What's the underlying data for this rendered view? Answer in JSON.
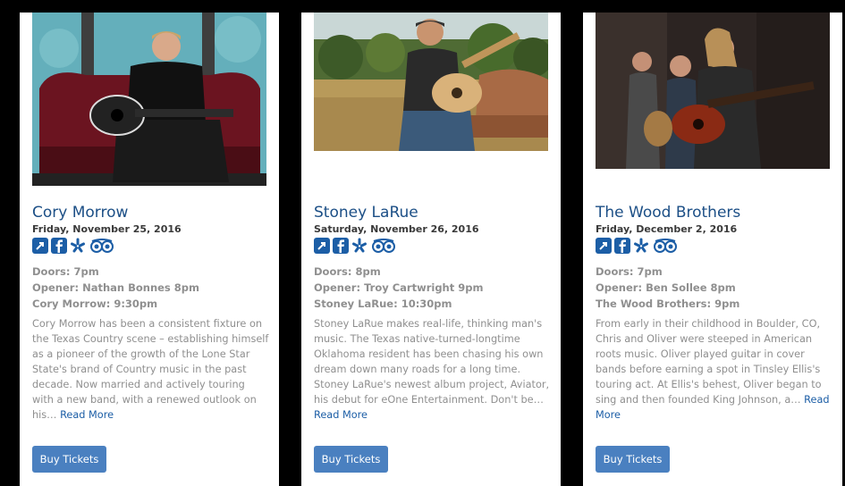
{
  "events": [
    {
      "artist": "Cory Morrow",
      "date": "Friday, November 25, 2016",
      "doors": "Doors: 7pm",
      "opener": "Opener: Nathan Bonnes 8pm",
      "headliner": "Cory Morrow: 9:30pm",
      "description": "Cory Morrow has been a consistent fixture on the Texas Country scene – establishing himself as a pioneer of the growth of the Lone Star State's brand of Country music in the past decade. Now married and actively touring with a new band, with a renewed outlook on his…",
      "read_more": "Read More",
      "buy_label": "Buy Tickets"
    },
    {
      "artist": "Stoney LaRue",
      "date": "Saturday, November 26, 2016",
      "doors": "Doors: 8pm",
      "opener": "Opener: Troy Cartwright 9pm",
      "headliner": "Stoney LaRue: 10:30pm",
      "description": "Stoney LaRue makes real-life, thinking man's music. The Texas native-turned-longtime Oklahoma resident has been chasing his own dream down many roads for a long time. Stoney LaRue's newest album project, Aviator, his debut for eOne Entertainment. Don't be…",
      "read_more": "Read More",
      "buy_label": "Buy Tickets"
    },
    {
      "artist": "The Wood Brothers",
      "date": "Friday, December 2, 2016",
      "doors": "Doors: 7pm",
      "opener": "Opener: Ben Sollee 8pm",
      "headliner": "The Wood Brothers: 9pm",
      "description": "From early in their childhood in Boulder, CO, Chris and Oliver were steeped in American roots music. Oliver played guitar in cover bands before earning a spot in Tinsley Ellis's touring act. At Ellis's behest, Oliver began to sing and then founded King Johnson, a…",
      "read_more": "Read More",
      "buy_label": "Buy Tickets"
    }
  ],
  "icons": [
    "external-link-icon",
    "facebook-icon",
    "yelp-icon",
    "tripadvisor-icon"
  ],
  "colors": {
    "title": "#1c4f86",
    "link": "#1c5ea6",
    "button": "#4a80c0",
    "muted": "#8f8f8f",
    "background": "#000000"
  }
}
